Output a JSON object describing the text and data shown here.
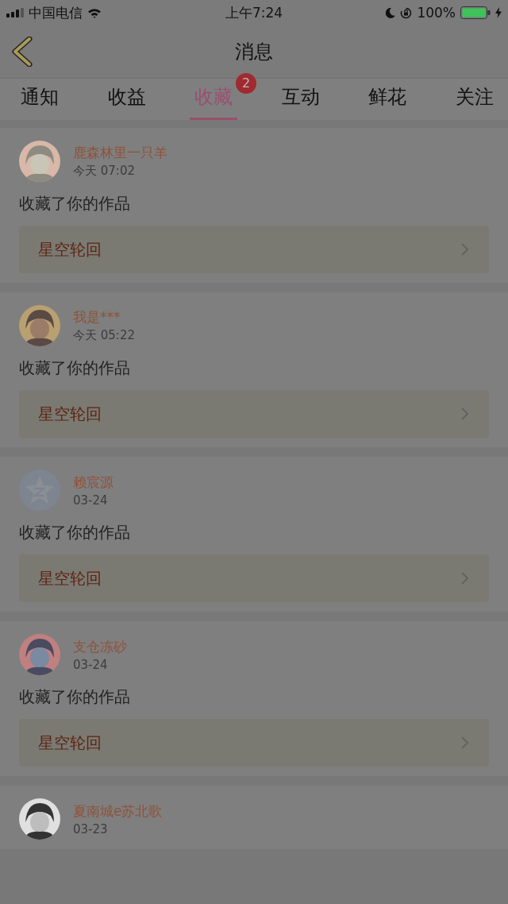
{
  "status_bar": {
    "carrier": "中国电信",
    "time": "上午7:24",
    "battery": "100%"
  },
  "nav": {
    "title": "消息"
  },
  "tabs": [
    {
      "label": "通知",
      "selected": false
    },
    {
      "label": "收益",
      "selected": false
    },
    {
      "label": "收藏",
      "selected": true,
      "badge": "2"
    },
    {
      "label": "互动",
      "selected": false
    },
    {
      "label": "鲜花",
      "selected": false
    },
    {
      "label": "关注",
      "selected": false
    }
  ],
  "messages": [
    {
      "kind": "picture",
      "name": "鹿森林里一只羊",
      "time": "今天 07:02",
      "action": "收藏了你的作品",
      "work": "星空轮回"
    },
    {
      "kind": "picture",
      "name": "我是***",
      "time": "今天 05:22",
      "action": "收藏了你的作品",
      "work": "星空轮回"
    },
    {
      "kind": "default",
      "name": "赖宸源",
      "time": "03-24",
      "action": "收藏了你的作品",
      "work": "星空轮回"
    },
    {
      "kind": "picture",
      "name": "支仓冻砂",
      "time": "03-24",
      "action": "收藏了你的作品",
      "work": "星空轮回"
    },
    {
      "kind": "picture",
      "name": "夏南城e苏北歌",
      "time": "03-23"
    }
  ]
}
